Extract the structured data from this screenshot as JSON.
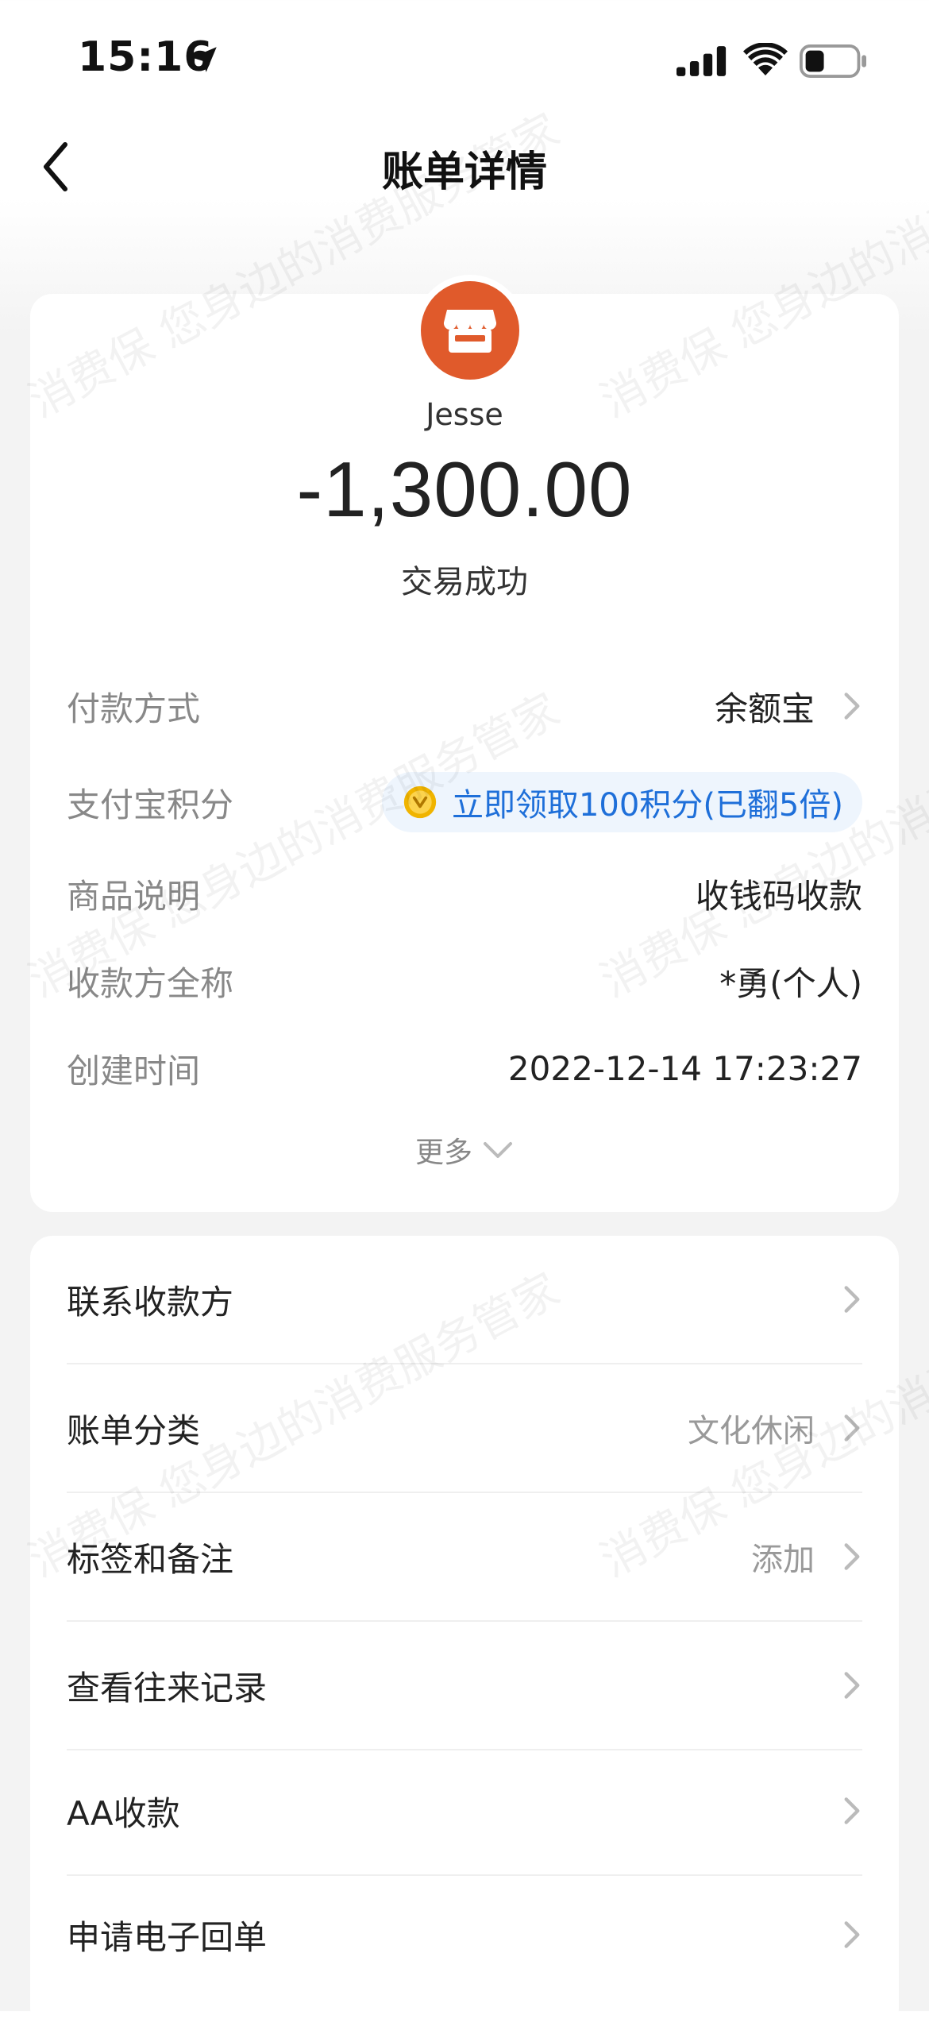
{
  "status_bar": {
    "time": "15:16",
    "icons": [
      "location-arrow-icon",
      "cellular-signal-icon",
      "wifi-icon",
      "battery-icon"
    ]
  },
  "nav": {
    "title": "账单详情",
    "back_icon": "chevron-left-icon"
  },
  "summary": {
    "merchant_icon": "store-icon",
    "merchant_icon_color": "#e05a2b",
    "merchant_name": "Jesse",
    "amount": "-1,300.00",
    "status": "交易成功",
    "details": [
      {
        "label": "付款方式",
        "value": "余额宝",
        "has_chevron": true
      },
      {
        "label": "支付宝积分",
        "value": "立即领取100积分(已翻5倍)",
        "pill": true
      },
      {
        "label": "商品说明",
        "value": "收钱码收款"
      },
      {
        "label": "收款方全称",
        "value": "*勇(个人)"
      },
      {
        "label": "创建时间",
        "value": "2022-12-14 17:23:27"
      }
    ],
    "more_label": "更多"
  },
  "actions": [
    {
      "label": "联系收款方",
      "value": ""
    },
    {
      "label": "账单分类",
      "value": "文化休闲"
    },
    {
      "label": "标签和备注",
      "value": "添加"
    },
    {
      "label": "查看往来记录",
      "value": ""
    },
    {
      "label": "AA收款",
      "value": ""
    },
    {
      "label": "申请电子回单",
      "value": ""
    }
  ],
  "watermark_text": "消费保 您身边的消费服务管家",
  "colors": {
    "accent_blue": "#1e6fd9",
    "pill_bg": "#eef5fd",
    "coin_gold": "#f0b400"
  }
}
